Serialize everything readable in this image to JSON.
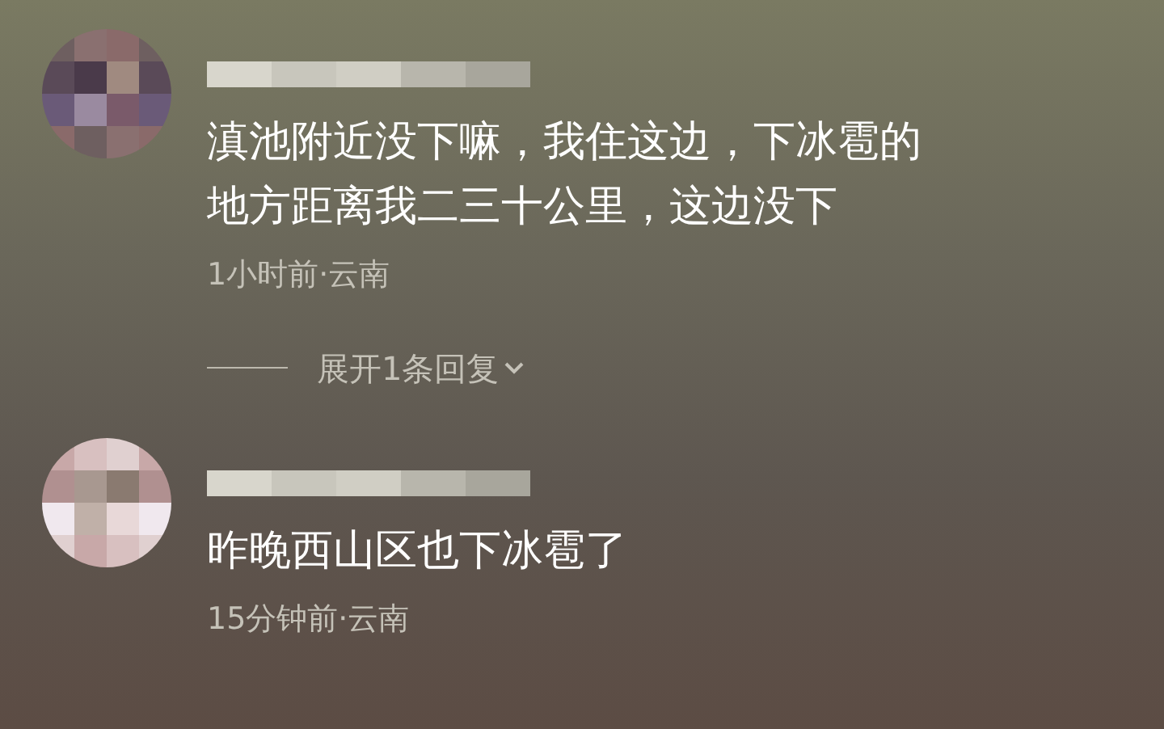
{
  "comments": [
    {
      "text": "滇池附近没下嘛，我住这边，下冰雹的地方距离我二三十公里，这边没下",
      "meta": "1小时前·云南",
      "replies": "展开1条回复"
    },
    {
      "text": "昨晚西山区也下冰雹了",
      "meta": "15分钟前·云南"
    }
  ]
}
